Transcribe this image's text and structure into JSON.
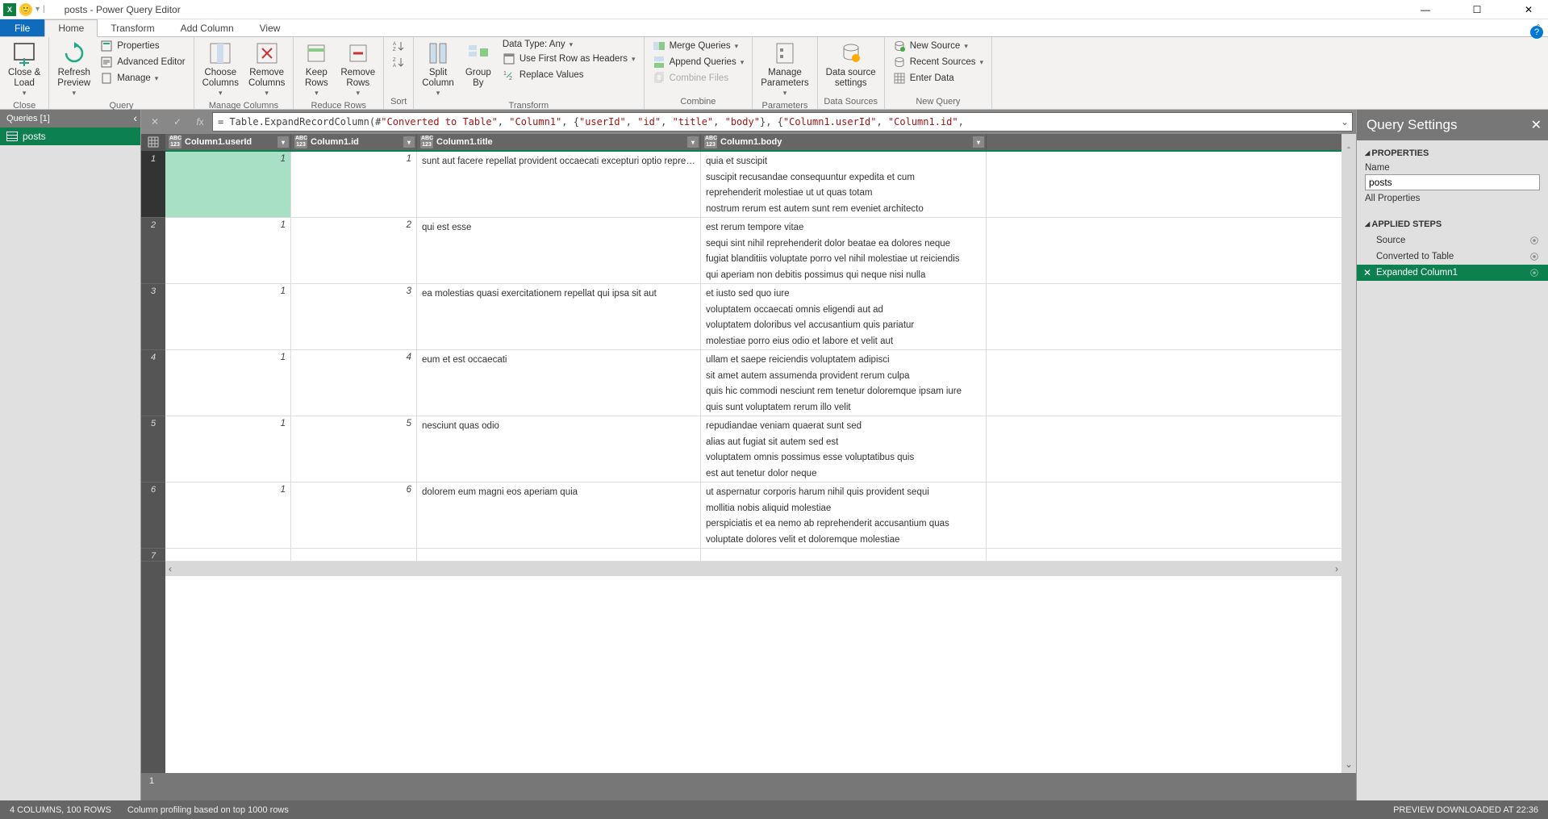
{
  "title": "posts - Power Query Editor",
  "ribbon_tabs": {
    "file": "File",
    "home": "Home",
    "transform": "Transform",
    "add_column": "Add Column",
    "view": "View"
  },
  "ribbon": {
    "close": {
      "close_load": "Close &\nLoad",
      "group": "Close"
    },
    "query": {
      "refresh": "Refresh\nPreview",
      "properties": "Properties",
      "advanced": "Advanced Editor",
      "manage": "Manage",
      "group": "Query"
    },
    "manage_cols": {
      "choose": "Choose\nColumns",
      "remove": "Remove\nColumns",
      "group": "Manage Columns"
    },
    "reduce": {
      "keep": "Keep\nRows",
      "remove": "Remove\nRows",
      "group": "Reduce Rows"
    },
    "sort": {
      "group": "Sort"
    },
    "transform": {
      "split": "Split\nColumn",
      "group_by": "Group\nBy",
      "data_type": "Data Type: Any",
      "first_row": "Use First Row as Headers",
      "replace": "Replace Values",
      "group": "Transform"
    },
    "combine": {
      "merge": "Merge Queries",
      "append": "Append Queries",
      "combine_files": "Combine Files",
      "group": "Combine"
    },
    "parameters": {
      "manage": "Manage\nParameters",
      "group": "Parameters"
    },
    "data_sources": {
      "settings": "Data source\nsettings",
      "group": "Data Sources"
    },
    "new_query": {
      "new_source": "New Source",
      "recent": "Recent Sources",
      "enter": "Enter Data",
      "group": "New Query"
    }
  },
  "queries": {
    "header": "Queries [1]",
    "items": [
      {
        "name": "posts"
      }
    ]
  },
  "formula": {
    "prefix": "= Table.ExpandRecordColumn(#",
    "s1": "\"Converted to Table\"",
    "c1": ", ",
    "s2": "\"Column1\"",
    "c2": ", {",
    "s3": "\"userId\"",
    "c3": ", ",
    "s4": "\"id\"",
    "c4": ", ",
    "s5": "\"title\"",
    "c5": ", ",
    "s6": "\"body\"",
    "c6": "}, {",
    "s7": "\"Column1.userId\"",
    "c7": ", ",
    "s8": "\"Column1.id\"",
    "c8": ","
  },
  "columns": {
    "userId": "Column1.userId",
    "id": "Column1.id",
    "title": "Column1.title",
    "body": "Column1.body"
  },
  "rows": [
    {
      "n": "1",
      "userId": "1",
      "id": "1",
      "title": "sunt aut facere repellat provident occaecati excepturi optio reprehend...",
      "body": [
        "quia et suscipit",
        "suscipit recusandae consequuntur expedita et cum",
        "reprehenderit molestiae ut ut quas totam",
        "nostrum rerum est autem sunt rem eveniet architecto"
      ]
    },
    {
      "n": "2",
      "userId": "1",
      "id": "2",
      "title": "qui est esse",
      "body": [
        "est rerum tempore vitae",
        "sequi sint nihil reprehenderit dolor beatae ea dolores neque",
        "fugiat blanditiis voluptate porro vel nihil molestiae ut reiciendis",
        "qui aperiam non debitis possimus qui neque nisi nulla"
      ]
    },
    {
      "n": "3",
      "userId": "1",
      "id": "3",
      "title": "ea molestias quasi exercitationem repellat qui ipsa sit aut",
      "body": [
        "et iusto sed quo iure",
        "voluptatem occaecati omnis eligendi aut ad",
        "voluptatem doloribus vel accusantium quis pariatur",
        "molestiae porro eius odio et labore et velit aut"
      ]
    },
    {
      "n": "4",
      "userId": "1",
      "id": "4",
      "title": "eum et est occaecati",
      "body": [
        "ullam et saepe reiciendis voluptatem adipisci",
        "sit amet autem assumenda provident rerum culpa",
        "quis hic commodi nesciunt rem tenetur doloremque ipsam iure",
        "quis sunt voluptatem rerum illo velit"
      ]
    },
    {
      "n": "5",
      "userId": "1",
      "id": "5",
      "title": "nesciunt quas odio",
      "body": [
        "repudiandae veniam quaerat sunt sed",
        "alias aut fugiat sit autem sed est",
        "voluptatem omnis possimus esse voluptatibus quis",
        "est aut tenetur dolor neque"
      ]
    },
    {
      "n": "6",
      "userId": "1",
      "id": "6",
      "title": "dolorem eum magni eos aperiam quia",
      "body": [
        "ut aspernatur corporis harum nihil quis provident sequi",
        "mollitia nobis aliquid molestiae",
        "perspiciatis et ea nemo ab reprehenderit accusantium quas",
        "voluptate dolores velit et doloremque molestiae"
      ]
    },
    {
      "n": "7",
      "userId": "",
      "id": "",
      "title": "",
      "body": [
        ""
      ]
    }
  ],
  "bottom_value": "1",
  "settings": {
    "title": "Query Settings",
    "properties": "PROPERTIES",
    "name_label": "Name",
    "name_value": "posts",
    "all_props": "All Properties",
    "applied_steps": "APPLIED STEPS",
    "steps": [
      {
        "name": "Source",
        "gear": true
      },
      {
        "name": "Converted to Table",
        "gear": true
      },
      {
        "name": "Expanded Column1",
        "gear": true,
        "active": true
      }
    ]
  },
  "status": {
    "cols": "4 COLUMNS, 100 ROWS",
    "profiling": "Column profiling based on top 1000 rows",
    "preview": "PREVIEW DOWNLOADED AT 22:36"
  }
}
